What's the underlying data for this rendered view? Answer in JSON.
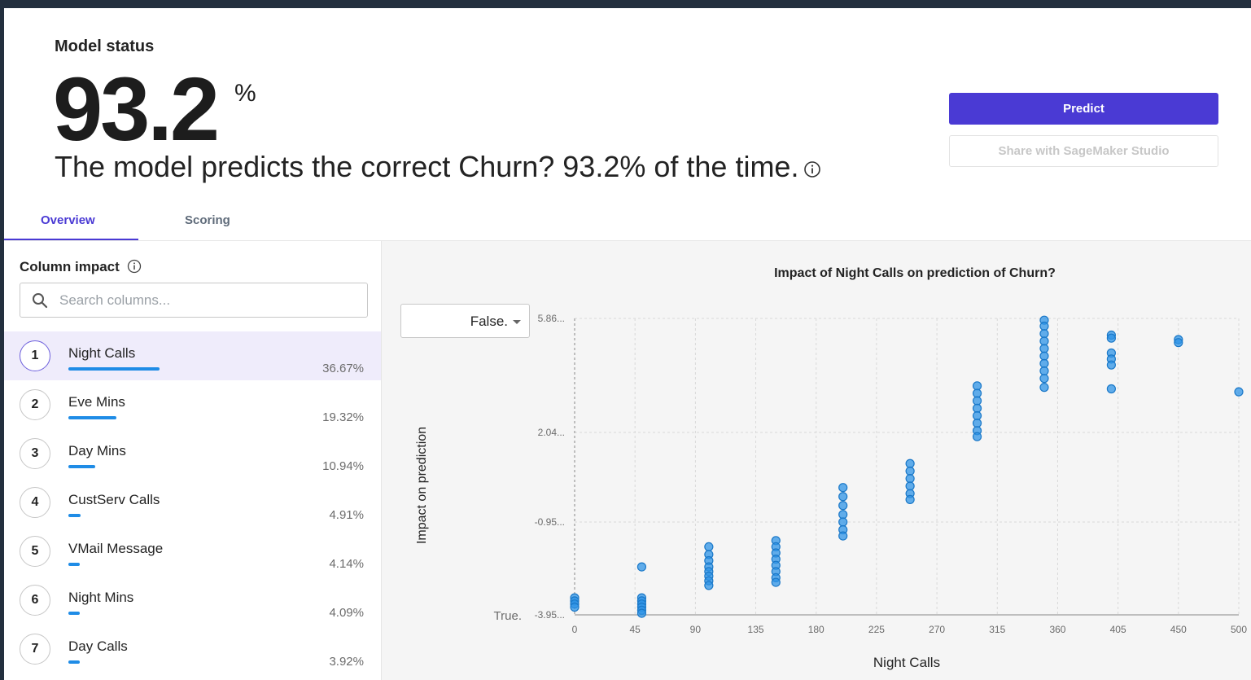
{
  "header": {
    "status_label": "Model status",
    "accuracy": "93.2",
    "percent_symbol": "%",
    "summary": "The model predicts the correct Churn? 93.2% of the time."
  },
  "actions": {
    "predict_label": "Predict",
    "share_label": "Share with SageMaker Studio"
  },
  "tabs": [
    {
      "label": "Overview",
      "active": true
    },
    {
      "label": "Scoring",
      "active": false
    }
  ],
  "column_impact": {
    "title": "Column impact",
    "search_placeholder": "Search columns...",
    "items": [
      {
        "rank": "1",
        "name": "Night Calls",
        "percent": "36.67%",
        "value": 36.67,
        "selected": true
      },
      {
        "rank": "2",
        "name": "Eve Mins",
        "percent": "19.32%",
        "value": 19.32,
        "selected": false
      },
      {
        "rank": "3",
        "name": "Day Mins",
        "percent": "10.94%",
        "value": 10.94,
        "selected": false
      },
      {
        "rank": "4",
        "name": "CustServ Calls",
        "percent": "4.91%",
        "value": 4.91,
        "selected": false
      },
      {
        "rank": "5",
        "name": "VMail Message",
        "percent": "4.14%",
        "value": 4.14,
        "selected": false
      },
      {
        "rank": "6",
        "name": "Night Mins",
        "percent": "4.09%",
        "value": 4.09,
        "selected": false
      },
      {
        "rank": "7",
        "name": "Day Calls",
        "percent": "3.92%",
        "value": 3.92,
        "selected": false
      }
    ]
  },
  "class_selector": {
    "value": "False."
  },
  "colors": {
    "accent": "#4a3ad4",
    "bar": "#1f8ce6",
    "point": "#2e93e6",
    "selected_row": "#efecfb"
  },
  "chart_data": {
    "type": "scatter",
    "title": "Impact of Night Calls on prediction of Churn?",
    "xlabel": "Night Calls",
    "ylabel": "Impact on prediction",
    "x_ticks": [
      "0",
      "45",
      "90",
      "135",
      "180",
      "225",
      "270",
      "315",
      "360",
      "405",
      "450",
      "500"
    ],
    "y_ticks": [
      {
        "label": "5.86...",
        "value": 5.86
      },
      {
        "label": "2.04...",
        "value": 2.04
      },
      {
        "label": "-0.95...",
        "value": -0.95
      },
      {
        "label": "-3.95...",
        "value": -3.95
      }
    ],
    "y_bottom_label": "True.",
    "xlim": [
      0,
      500
    ],
    "ylim": [
      -3.95,
      5.86
    ],
    "grid": true,
    "points": [
      {
        "x": 0,
        "y": -3.4
      },
      {
        "x": 0,
        "y": -3.5
      },
      {
        "x": 0,
        "y": -3.6
      },
      {
        "x": 0,
        "y": -3.7
      },
      {
        "x": 50,
        "y": -2.4
      },
      {
        "x": 50,
        "y": -3.4
      },
      {
        "x": 50,
        "y": -3.5
      },
      {
        "x": 50,
        "y": -3.6
      },
      {
        "x": 50,
        "y": -3.7
      },
      {
        "x": 50,
        "y": -3.8
      },
      {
        "x": 50,
        "y": -3.9
      },
      {
        "x": 100,
        "y": -1.75
      },
      {
        "x": 100,
        "y": -2.0
      },
      {
        "x": 100,
        "y": -2.2
      },
      {
        "x": 100,
        "y": -2.4
      },
      {
        "x": 100,
        "y": -2.55
      },
      {
        "x": 100,
        "y": -2.7
      },
      {
        "x": 100,
        "y": -2.85
      },
      {
        "x": 100,
        "y": -3.0
      },
      {
        "x": 150,
        "y": -1.55
      },
      {
        "x": 150,
        "y": -1.75
      },
      {
        "x": 150,
        "y": -1.95
      },
      {
        "x": 150,
        "y": -2.15
      },
      {
        "x": 150,
        "y": -2.35
      },
      {
        "x": 150,
        "y": -2.55
      },
      {
        "x": 150,
        "y": -2.75
      },
      {
        "x": 150,
        "y": -2.9
      },
      {
        "x": 200,
        "y": 0.2
      },
      {
        "x": 200,
        "y": -0.1
      },
      {
        "x": 200,
        "y": -0.4
      },
      {
        "x": 200,
        "y": -0.7
      },
      {
        "x": 200,
        "y": -0.95
      },
      {
        "x": 200,
        "y": -1.2
      },
      {
        "x": 200,
        "y": -1.4
      },
      {
        "x": 250,
        "y": 1.0
      },
      {
        "x": 250,
        "y": 0.75
      },
      {
        "x": 250,
        "y": 0.5
      },
      {
        "x": 250,
        "y": 0.25
      },
      {
        "x": 250,
        "y": 0.0
      },
      {
        "x": 250,
        "y": -0.2
      },
      {
        "x": 300,
        "y": 3.6
      },
      {
        "x": 300,
        "y": 3.35
      },
      {
        "x": 300,
        "y": 3.1
      },
      {
        "x": 300,
        "y": 2.85
      },
      {
        "x": 300,
        "y": 2.6
      },
      {
        "x": 300,
        "y": 2.35
      },
      {
        "x": 300,
        "y": 2.1
      },
      {
        "x": 300,
        "y": 1.9
      },
      {
        "x": 350,
        "y": 5.8
      },
      {
        "x": 350,
        "y": 5.6
      },
      {
        "x": 350,
        "y": 5.35
      },
      {
        "x": 350,
        "y": 5.1
      },
      {
        "x": 350,
        "y": 4.85
      },
      {
        "x": 350,
        "y": 4.6
      },
      {
        "x": 350,
        "y": 4.35
      },
      {
        "x": 350,
        "y": 4.1
      },
      {
        "x": 350,
        "y": 3.85
      },
      {
        "x": 350,
        "y": 3.55
      },
      {
        "x": 400,
        "y": 5.3
      },
      {
        "x": 400,
        "y": 5.2
      },
      {
        "x": 400,
        "y": 4.7
      },
      {
        "x": 400,
        "y": 4.5
      },
      {
        "x": 400,
        "y": 4.3
      },
      {
        "x": 400,
        "y": 3.5
      },
      {
        "x": 450,
        "y": 5.15
      },
      {
        "x": 450,
        "y": 5.05
      },
      {
        "x": 500,
        "y": 3.4
      }
    ]
  }
}
